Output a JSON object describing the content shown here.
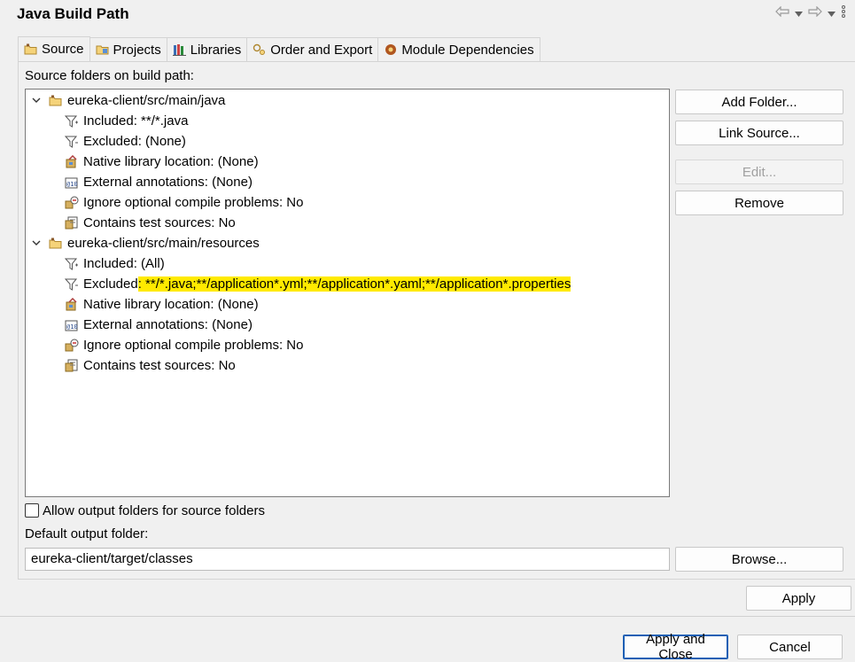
{
  "window": {
    "title": "Java Build Path"
  },
  "tabs": [
    {
      "label": "Source",
      "icon": "source-folder-icon",
      "active": true
    },
    {
      "label": "Projects",
      "icon": "projects-icon",
      "active": false
    },
    {
      "label": "Libraries",
      "icon": "libraries-icon",
      "active": false
    },
    {
      "label": "Order and Export",
      "icon": "order-export-icon",
      "active": false
    },
    {
      "label": "Module Dependencies",
      "icon": "module-icon",
      "active": false
    }
  ],
  "source": {
    "heading": "Source folders on build path:",
    "folders": [
      {
        "name": "eureka-client/src/main/java",
        "entries": [
          {
            "label": "Included: **/*.java",
            "icon": "filter-icon"
          },
          {
            "label": "Excluded: (None)",
            "icon": "filter-icon"
          },
          {
            "label": "Native library location: (None)",
            "icon": "native-library-icon"
          },
          {
            "label": "External annotations: (None)",
            "icon": "annotations-icon"
          },
          {
            "label": "Ignore optional compile problems: No",
            "icon": "ignore-problems-icon"
          },
          {
            "label": "Contains test sources: No",
            "icon": "test-sources-icon"
          }
        ]
      },
      {
        "name": "eureka-client/src/main/resources",
        "entries": [
          {
            "label": "Included: (All)",
            "icon": "filter-icon"
          },
          {
            "label": "Excluded",
            "highlight": ": **/*.java;**/application*.yml;**/application*.yaml;**/application*.properties",
            "icon": "filter-icon"
          },
          {
            "label": "Native library location: (None)",
            "icon": "native-library-icon"
          },
          {
            "label": "External annotations: (None)",
            "icon": "annotations-icon"
          },
          {
            "label": "Ignore optional compile problems: No",
            "icon": "ignore-problems-icon"
          },
          {
            "label": "Contains test sources: No",
            "icon": "test-sources-icon"
          }
        ]
      }
    ],
    "buttons": {
      "add_folder": "Add Folder...",
      "link_source": "Link Source...",
      "edit": "Edit...",
      "remove": "Remove"
    },
    "allow_output_label": "Allow output folders for source folders",
    "default_output_label": "Default output folder:",
    "default_output_value": "eureka-client/target/classes",
    "browse": "Browse..."
  },
  "footer": {
    "apply": "Apply",
    "apply_and_close": "Apply and Close",
    "cancel": "Cancel"
  },
  "colors": {
    "highlight": "#ffea00",
    "default_button_border": "#1a5fb4"
  }
}
